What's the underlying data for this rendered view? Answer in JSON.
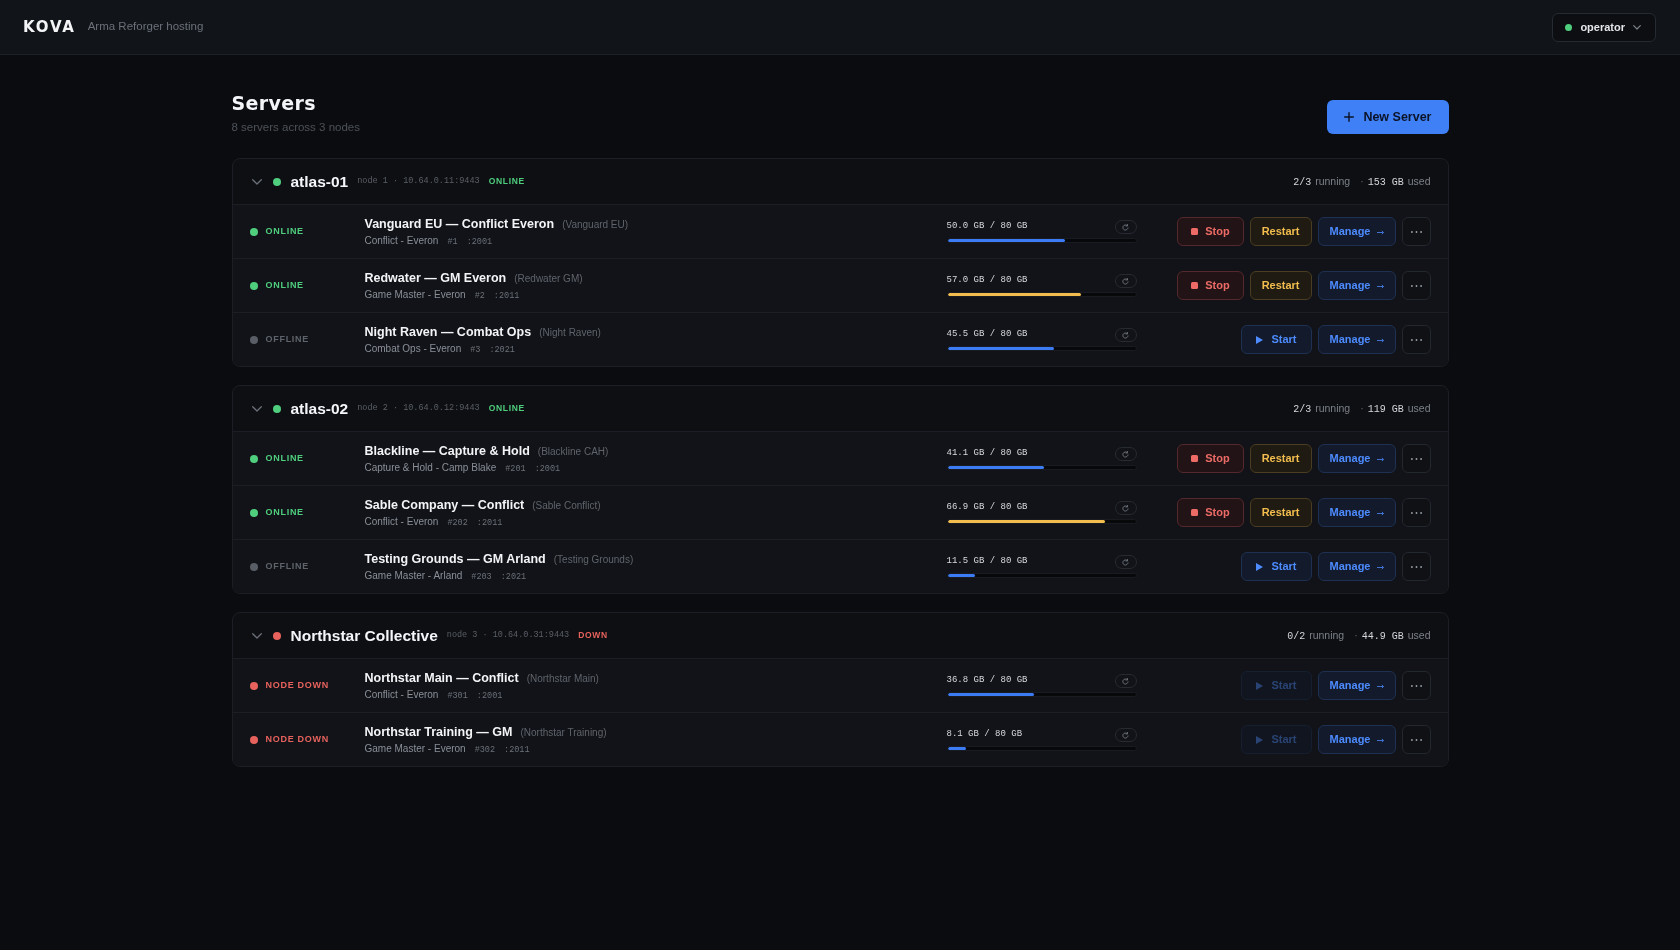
{
  "header": {
    "logo": "KOVA",
    "tagline": "Arma Reforger hosting",
    "user": {
      "name": "operator",
      "online": true
    }
  },
  "page": {
    "title": "Servers",
    "subtitle": "8 servers across 3 nodes",
    "new_server_button": "New Server"
  },
  "nodes": [
    {
      "name": "atlas-01",
      "meta": "node 1 · 10.64.0.11:9443",
      "kind": "online",
      "status_label": "ONLINE",
      "expanded": true,
      "running_count": "2/3",
      "running_label": "running",
      "separator": "·",
      "used_amount": "153 GB",
      "used_label": "used",
      "servers": [
        {
          "kind": "online",
          "status_label": "ONLINE",
          "name": "Vanguard EU — Conflict Everon",
          "alias": "(Vanguard EU)",
          "mode": "Conflict - Everon",
          "number": "#1",
          "port": ":2001",
          "storage": "50.0 GB / 80 GB",
          "level": 0.625,
          "actions": [
            {
              "kind": "stop",
              "label": "Stop",
              "disabled": false
            },
            {
              "kind": "restart",
              "label": "Restart",
              "disabled": false
            },
            {
              "kind": "manage",
              "label": "Manage",
              "disabled": false
            },
            {
              "kind": "more",
              "disabled": false
            }
          ]
        },
        {
          "kind": "online",
          "status_label": "ONLINE",
          "name": "Redwater — GM Everon",
          "alias": "(Redwater GM)",
          "mode": "Game Master - Everon",
          "number": "#2",
          "port": ":2011",
          "storage": "57.0 GB / 80 GB",
          "level": 0.7125,
          "actions": [
            {
              "kind": "stop",
              "label": "Stop",
              "disabled": false
            },
            {
              "kind": "restart",
              "label": "Restart",
              "disabled": false
            },
            {
              "kind": "manage",
              "label": "Manage",
              "disabled": false
            },
            {
              "kind": "more",
              "disabled": false
            }
          ]
        },
        {
          "kind": "offline",
          "status_label": "OFFLINE",
          "name": "Night Raven — Combat Ops",
          "alias": "(Night Raven)",
          "mode": "Combat Ops - Everon",
          "number": "#3",
          "port": ":2021",
          "storage": "45.5 GB / 80 GB",
          "level": 0.569,
          "actions": [
            {
              "kind": "start",
              "label": "Start",
              "disabled": false
            },
            {
              "kind": "manage",
              "label": "Manage",
              "disabled": false
            },
            {
              "kind": "more",
              "disabled": false
            }
          ]
        }
      ]
    },
    {
      "name": "atlas-02",
      "meta": "node 2 · 10.64.0.12:9443",
      "kind": "online",
      "status_label": "ONLINE",
      "expanded": true,
      "running_count": "2/3",
      "running_label": "running",
      "separator": "·",
      "used_amount": "119 GB",
      "used_label": "used",
      "servers": [
        {
          "kind": "online",
          "status_label": "ONLINE",
          "name": "Blackline — Capture & Hold",
          "alias": "(Blackline CAH)",
          "mode": "Capture & Hold - Camp Blake",
          "number": "#201",
          "port": ":2001",
          "storage": "41.1 GB / 80 GB",
          "level": 0.514,
          "actions": [
            {
              "kind": "stop",
              "label": "Stop",
              "disabled": false
            },
            {
              "kind": "restart",
              "label": "Restart",
              "disabled": false
            },
            {
              "kind": "manage",
              "label": "Manage",
              "disabled": false
            },
            {
              "kind": "more",
              "disabled": false
            }
          ]
        },
        {
          "kind": "online",
          "status_label": "ONLINE",
          "name": "Sable Company — Conflict",
          "alias": "(Sable Conflict)",
          "mode": "Conflict - Everon",
          "number": "#202",
          "port": ":2011",
          "storage": "66.9 GB / 80 GB",
          "level": 0.836,
          "actions": [
            {
              "kind": "stop",
              "label": "Stop",
              "disabled": false
            },
            {
              "kind": "restart",
              "label": "Restart",
              "disabled": false
            },
            {
              "kind": "manage",
              "label": "Manage",
              "disabled": false
            },
            {
              "kind": "more",
              "disabled": false
            }
          ]
        },
        {
          "kind": "offline",
          "status_label": "OFFLINE",
          "name": "Testing Grounds — GM Arland",
          "alias": "(Testing Grounds)",
          "mode": "Game Master - Arland",
          "number": "#203",
          "port": ":2021",
          "storage": "11.5 GB / 80 GB",
          "level": 0.144,
          "actions": [
            {
              "kind": "start",
              "label": "Start",
              "disabled": false
            },
            {
              "kind": "manage",
              "label": "Manage",
              "disabled": false
            },
            {
              "kind": "more",
              "disabled": false
            }
          ]
        }
      ]
    },
    {
      "name": "Northstar Collective",
      "meta": "node 3 · 10.64.0.31:9443",
      "kind": "down",
      "status_label": "DOWN",
      "expanded": true,
      "running_count": "0/2",
      "running_label": "running",
      "separator": "·",
      "used_amount": "44.9 GB",
      "used_label": "used",
      "servers": [
        {
          "kind": "node_down",
          "status_label": "NODE DOWN",
          "name": "Northstar Main — Conflict",
          "alias": "(Northstar Main)",
          "mode": "Conflict - Everon",
          "number": "#301",
          "port": ":2001",
          "storage": "36.8 GB / 80 GB",
          "level": 0.46,
          "actions": [
            {
              "kind": "start",
              "label": "Start",
              "disabled": true
            },
            {
              "kind": "manage",
              "label": "Manage",
              "disabled": false
            },
            {
              "kind": "more",
              "disabled": false
            }
          ]
        },
        {
          "kind": "node_down",
          "status_label": "NODE DOWN",
          "name": "Northstar Training — GM",
          "alias": "(Northstar Training)",
          "mode": "Game Master - Everon",
          "number": "#302",
          "port": ":2011",
          "storage": "8.1 GB / 80 GB",
          "level": 0.101,
          "actions": [
            {
              "kind": "start",
              "label": "Start",
              "disabled": true
            },
            {
              "kind": "manage",
              "label": "Manage",
              "disabled": false
            },
            {
              "kind": "more",
              "disabled": false
            }
          ]
        }
      ]
    }
  ]
}
